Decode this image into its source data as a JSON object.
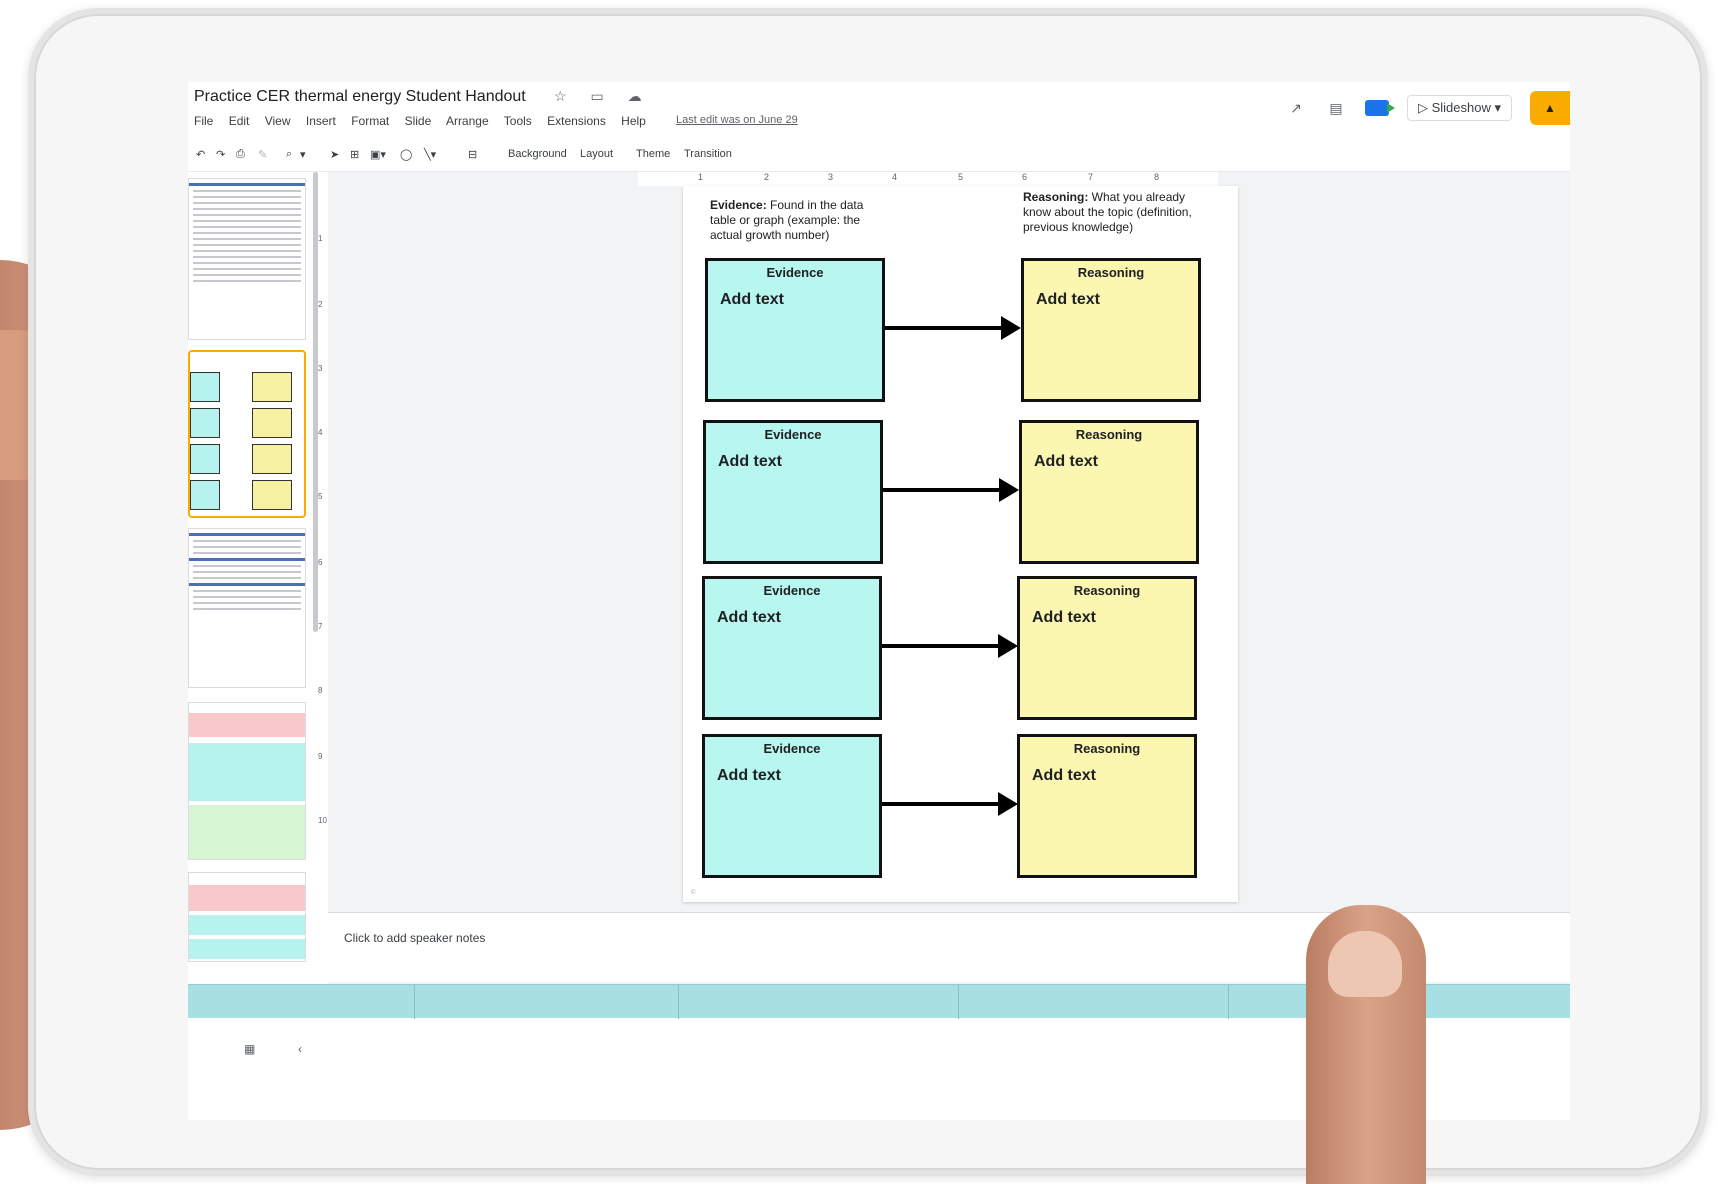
{
  "app": {
    "doc_title": "Practice CER thermal energy Student Handout",
    "menu": [
      "File",
      "Edit",
      "View",
      "Insert",
      "Format",
      "Slide",
      "Arrange",
      "Tools",
      "Extensions",
      "Help"
    ],
    "last_edit": "Last edit was on June 29",
    "slideshow_label": "Slideshow"
  },
  "toolbar": {
    "background": "Background",
    "layout": "Layout",
    "theme": "Theme",
    "transition": "Transition"
  },
  "ruler": {
    "top": [
      "1",
      "2",
      "3",
      "4",
      "5",
      "6",
      "7",
      "8"
    ],
    "left": [
      "1",
      "2",
      "3",
      "4",
      "5",
      "6",
      "7",
      "8",
      "9",
      "10"
    ]
  },
  "slide": {
    "evidence_header_bold": "Evidence:",
    "evidence_header_text": " Found in the data table or graph (example: the actual growth number)",
    "reasoning_header_bold": "Reasoning:",
    "reasoning_header_text": " What you already know about the topic (definition, previous knowledge)",
    "rows": [
      {
        "evidence_title": "Evidence",
        "evidence_text": "Add text",
        "reasoning_title": "Reasoning",
        "reasoning_text": "Add text"
      },
      {
        "evidence_title": "Evidence",
        "evidence_text": "Add text",
        "reasoning_title": "Reasoning",
        "reasoning_text": "Add text"
      },
      {
        "evidence_title": "Evidence",
        "evidence_text": "Add text",
        "reasoning_title": "Reasoning",
        "reasoning_text": "Add text"
      },
      {
        "evidence_title": "Evidence",
        "evidence_text": "Add text",
        "reasoning_title": "Reasoning",
        "reasoning_text": "Add text"
      }
    ]
  },
  "notes": {
    "placeholder": "Click to add speaker notes"
  },
  "colors": {
    "evidence_box": "#b7f7ef",
    "reasoning_box": "#fbf6b0",
    "selected_thumb_border": "#f9ab00",
    "share_button": "#f9ab00",
    "meet_blue": "#1a73e8"
  },
  "icons": {
    "star": "☆",
    "move": "▭",
    "cloud": "☁",
    "activity": "↗",
    "comments": "▤",
    "undo": "↶",
    "redo": "↷",
    "print": "⎙",
    "zoom": "⌕",
    "select": "➤",
    "collapse": "‹",
    "grid": "▦"
  }
}
